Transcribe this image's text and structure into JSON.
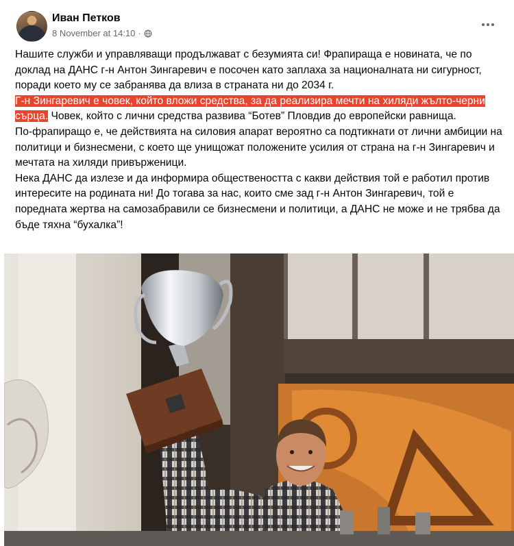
{
  "post": {
    "author": "Иван Петков",
    "timestamp": "8 November at 14:10",
    "separator": "·",
    "paragraph1": "Нашите служби и управляващи продължават с безумията си! Фрапираща е новината, че по доклад на ДАНС г-н Антон Зингаревич е посочен като заплаха за националната ни сигурност, поради което му се забранява да влиза в страната ни до 2034 г.",
    "highlight": "Г-н Зингаревич е човек, който вложи средства, за да реализира мечти на хиляди жълто-черни сърца.",
    "paragraph2_rest": " Човек, който с лични средства развива “Ботев” Пловдив до европейски равнища.",
    "paragraph3": "По-фрапиращо е, че действията на силовия апарат вероятно са подтикнати от лични амбиции на  политици и бизнесмени, с което ще унищожат положените усилия от страна на г-н Зингаревич и мечтата на хиляди привърженици.",
    "paragraph4": "Нека ДАНС да излезе и да информира обществеността с какви действия той е работил против интересите на родината ни! До тогава за нас, които сме зад г-н Антон Зингаревич, той е поредната жертва на самозабравили се бизнесмени и политици, а ДАНС не може и не трябва да бъде тяхна “бухалка”!"
  },
  "icons": {
    "privacy": "globe-icon",
    "menu": "more-options-icon"
  },
  "colors": {
    "highlight_bg": "#e8452e",
    "highlight_text": "#ffffff",
    "meta_text": "#65676b"
  }
}
